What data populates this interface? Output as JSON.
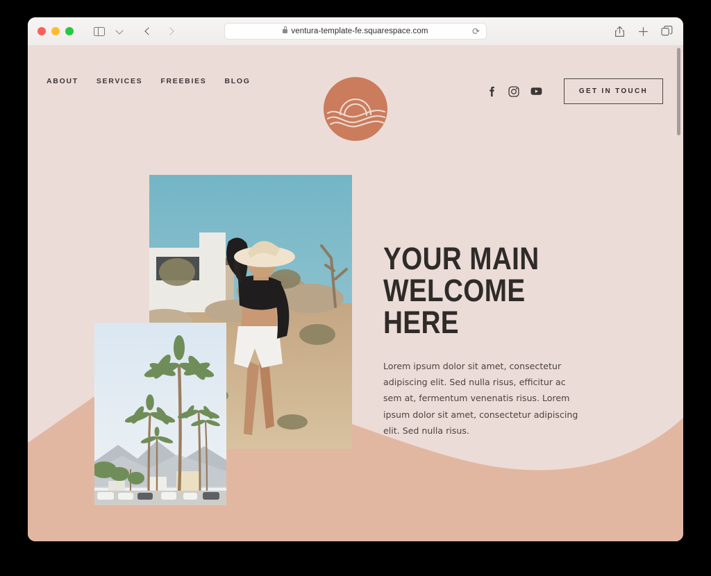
{
  "browser": {
    "url": "ventura-template-fe.squarespace.com",
    "lock_icon": "lock-icon",
    "reload_glyph": "⟳",
    "sidebar_icon": "sidebar-icon",
    "back_icon": "chevron-left-icon",
    "forward_icon": "chevron-right-icon",
    "share_glyph": "↑",
    "newtab_glyph": "+",
    "tabs_glyph": "❐"
  },
  "site": {
    "nav": [
      {
        "label": "ABOUT"
      },
      {
        "label": "SERVICES"
      },
      {
        "label": "FREEBIES"
      },
      {
        "label": "BLOG"
      }
    ],
    "logo": {
      "name": "sunset-wave-logo",
      "circle_color": "#ca7c5c",
      "line_color": "#eedcd4"
    },
    "social": [
      {
        "name": "facebook-icon",
        "label": "f"
      },
      {
        "name": "instagram-icon",
        "label": ""
      },
      {
        "name": "youtube-icon",
        "label": ""
      }
    ],
    "cta_label": "GET IN TOUCH",
    "hero": {
      "title": "YOUR MAIN\nWELCOME HERE",
      "body": "Lorem ipsum dolor sit amet, consectetur adipiscing elit. Sed nulla risus, efficitur ac sem at, fermentum venenatis risus. Lorem ipsum dolor sit amet, consectetur adipiscing elit. Sed nulla risus."
    },
    "images": [
      {
        "name": "desert-portrait-photo",
        "alt": "Woman in cowboy hat walking in desert by white stucco house"
      },
      {
        "name": "palm-trees-photo",
        "alt": "Tall palm trees against pale sky with mountains and parked cars"
      }
    ],
    "colors": {
      "page_background": "#ecdcd7",
      "wave_band": "#e2b7a1",
      "text_dark": "#2e2b29",
      "accent": "#ca7c5c"
    }
  }
}
